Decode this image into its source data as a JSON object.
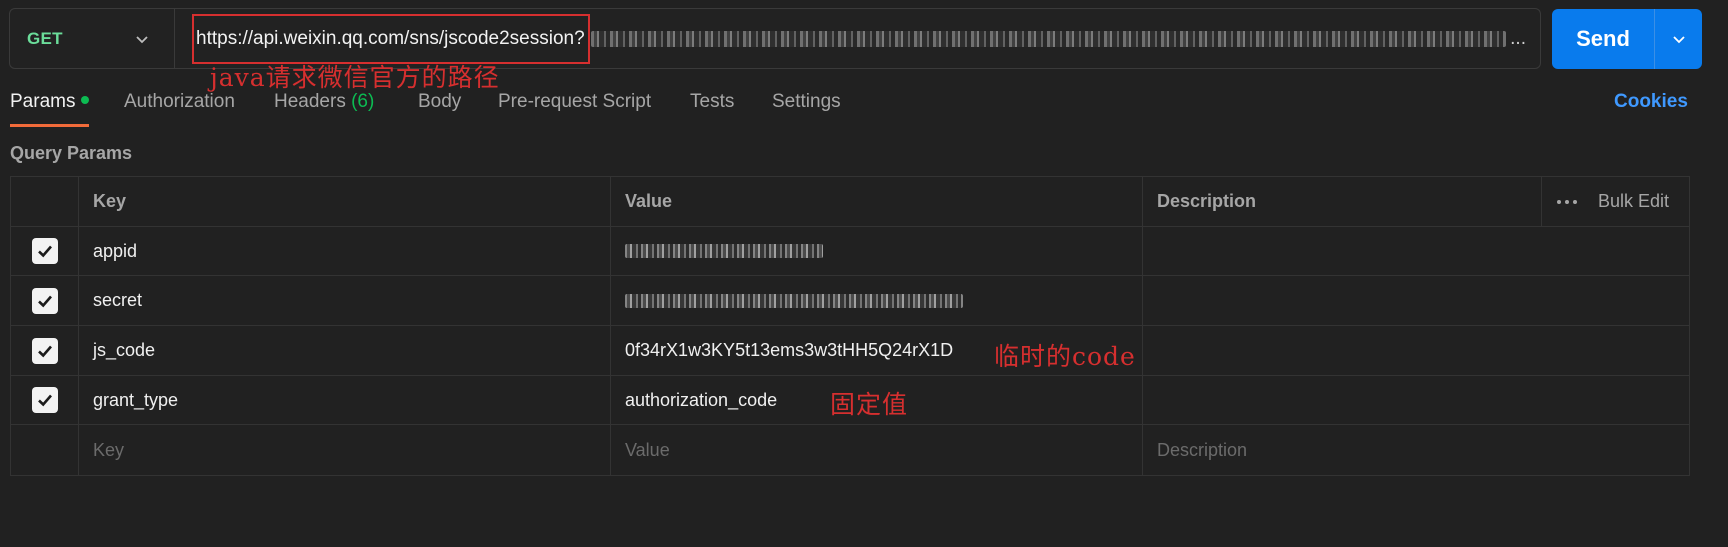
{
  "request": {
    "method": "GET",
    "url": "https://api.weixin.qq.com/sns/jscode2session?",
    "url_ellipsis": "..."
  },
  "send": {
    "label": "Send"
  },
  "tabs": [
    {
      "label": "Params",
      "active": true,
      "dot": true
    },
    {
      "label": "Authorization"
    },
    {
      "label": "Headers",
      "count": "(6)"
    },
    {
      "label": "Body"
    },
    {
      "label": "Pre-request Script"
    },
    {
      "label": "Tests"
    },
    {
      "label": "Settings"
    }
  ],
  "cookies_label": "Cookies",
  "section_title": "Query Params",
  "table": {
    "headers": {
      "key": "Key",
      "value": "Value",
      "description": "Description",
      "bulk_edit": "Bulk Edit"
    },
    "rows": [
      {
        "checked": true,
        "key": "appid",
        "value": "",
        "redacted": true
      },
      {
        "checked": true,
        "key": "secret",
        "value": "",
        "redacted": true
      },
      {
        "checked": true,
        "key": "js_code",
        "value": "0f34rX1w3KY5t13ems3w3tHH5Q24rX1D",
        "redacted": false
      },
      {
        "checked": true,
        "key": "grant_type",
        "value": "authorization_code",
        "redacted": false
      }
    ],
    "placeholder": {
      "key": "Key",
      "value": "Value",
      "description": "Description"
    }
  },
  "annotations": {
    "url": "java请求微信官方的路径",
    "js_code": "临时的code",
    "grant_type": "固定值"
  },
  "colors": {
    "method": "#6bdd9a",
    "send": "#097bed",
    "accent": "#f26b3a",
    "annotation": "#d62f2f",
    "link": "#3f99ff"
  }
}
